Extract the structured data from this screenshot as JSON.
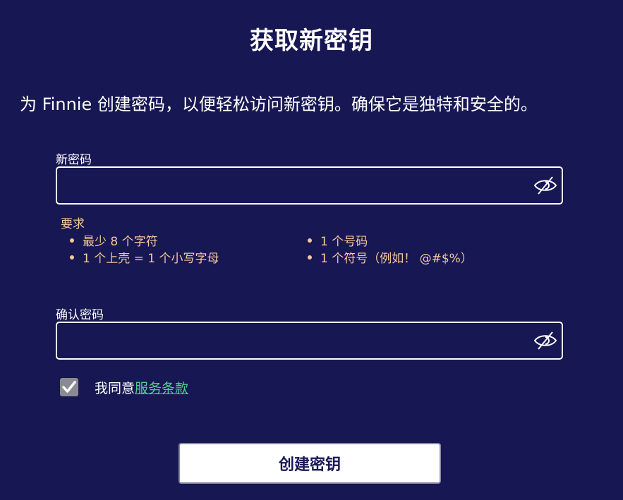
{
  "header": {
    "title": "获取新密钥",
    "subtitle": "为 Finnie 创建密码，以便轻松访问新密钥。确保它是独特和安全的。"
  },
  "new_password": {
    "label": "新密码",
    "value": "",
    "visibility_icon": "eye-off-icon"
  },
  "requirements": {
    "title": "要求",
    "items": [
      "最少 8 个字符",
      "1 个号码",
      "1 个上壳 = 1 个小写字母",
      "1 个符号（例如！ @#$%）"
    ]
  },
  "confirm_password": {
    "label": "确认密码",
    "value": "",
    "visibility_icon": "eye-off-icon"
  },
  "terms": {
    "checked": true,
    "prefix": "我同意",
    "link_text": "服务条款"
  },
  "actions": {
    "create_label": "创建密钥"
  },
  "colors": {
    "background": "#171753",
    "requirement_text": "#f5c89a",
    "link": "#4fd08f",
    "button_bg": "#ffffff",
    "button_text": "#171753"
  }
}
